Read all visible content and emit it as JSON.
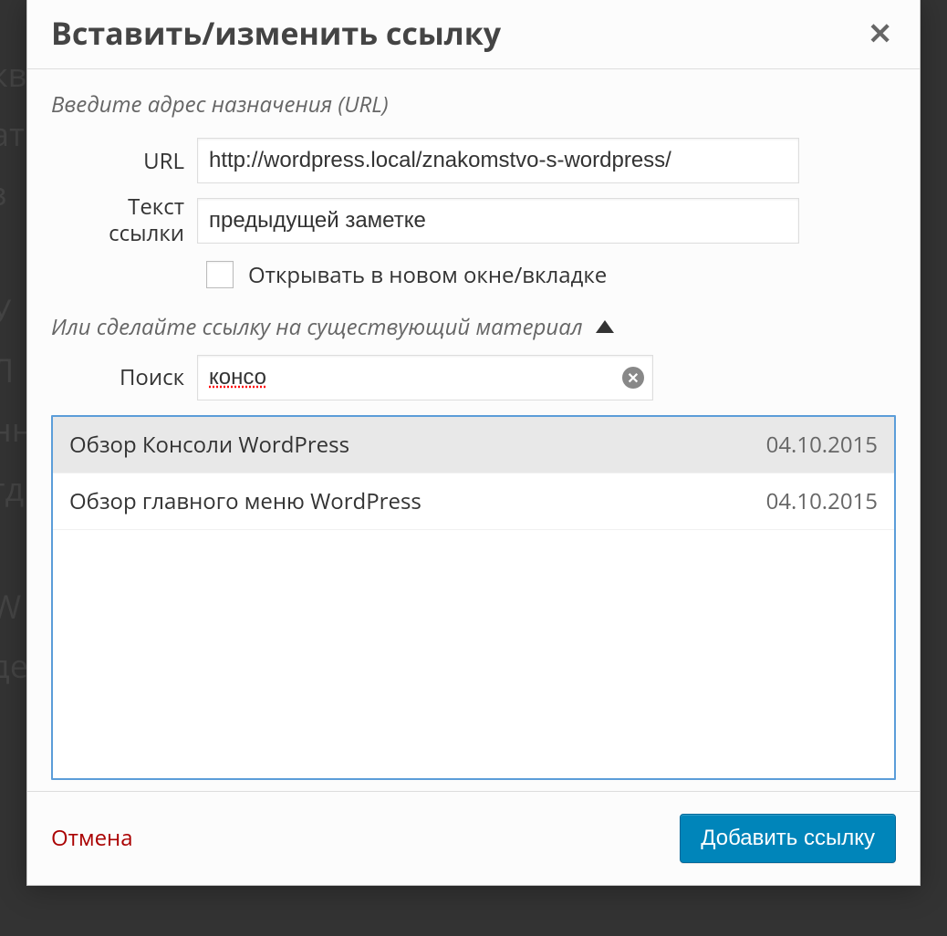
{
  "dialog": {
    "title": "Вставить/изменить ссылку",
    "section1_label": "Введите адрес назначения (URL)",
    "url_label": "URL",
    "url_value": "http://wordpress.local/znakomstvo-s-wordpress/",
    "text_label_line1": "Текст",
    "text_label_line2": "ссылки",
    "text_value": "предыдущей заметке",
    "new_tab_label": "Открывать в новом окне/вкладке",
    "new_tab_checked": false,
    "section2_label": "Или сделайте ссылку на существующий материал",
    "search_label": "Поиск",
    "search_value": "консо"
  },
  "results": [
    {
      "title": "Обзор Консоли WordPress",
      "date": "04.10.2015",
      "selected": true
    },
    {
      "title": "Обзор главного меню WordPress",
      "date": "04.10.2015",
      "selected": false
    }
  ],
  "footer": {
    "cancel": "Отмена",
    "submit": "Добавить ссылку"
  }
}
